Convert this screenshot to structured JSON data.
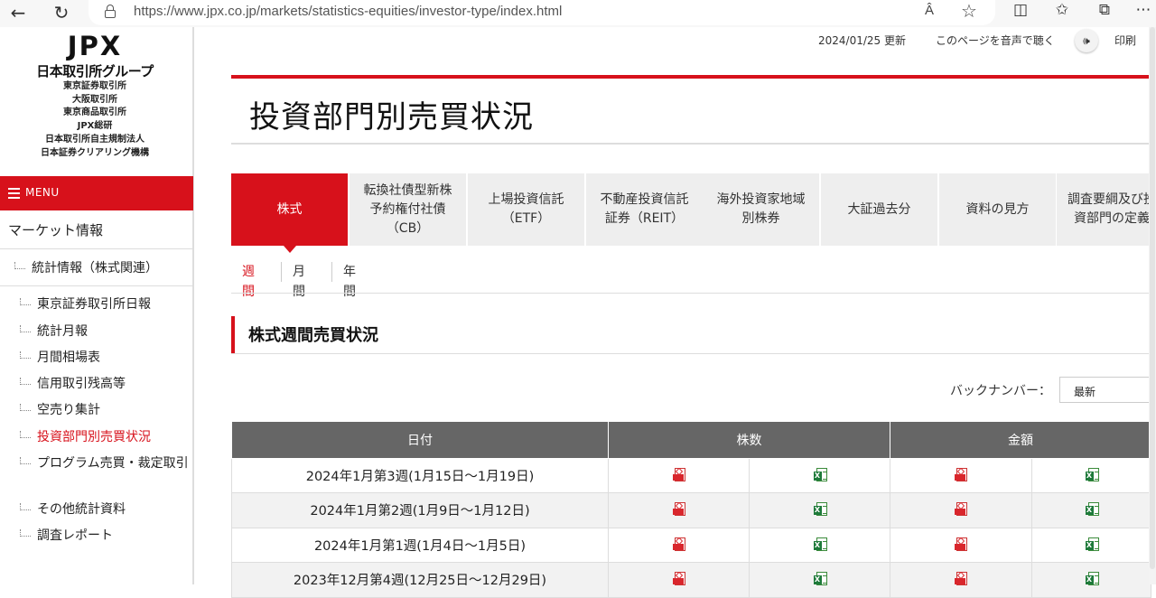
{
  "browser": {
    "url": "https://www.jpx.co.jp/markets/statistics-equities/investor-type/index.html",
    "read_aloud_label": "Â",
    "icons": [
      "back-icon",
      "refresh-icon",
      "lock-icon",
      "favorite-star-icon",
      "split-screen-icon",
      "favorites-icon",
      "collections-icon",
      "more-icon"
    ]
  },
  "logo": {
    "brand": "JPX",
    "group": "日本取引所グループ",
    "subsidiaries": [
      "東京証券取引所",
      "大阪取引所",
      "東京商品取引所",
      "JPX総研",
      "日本取引所自主規制法人",
      "日本証券クリアリング機構"
    ]
  },
  "sidebar": {
    "menu_label": "MENU",
    "heading": "マーケット情報",
    "level1": "統計情報（株式関連）",
    "items": [
      {
        "label": "東京証券取引所日報",
        "active": false
      },
      {
        "label": "統計月報",
        "active": false
      },
      {
        "label": "月間相場表",
        "active": false
      },
      {
        "label": "信用取引残高等",
        "active": false
      },
      {
        "label": "空売り集計",
        "active": false
      },
      {
        "label": "投資部門別売買状況",
        "active": true
      },
      {
        "label": "プログラム売買・裁定取引",
        "active": false
      },
      {
        "label": "その他統計資料",
        "active": false
      },
      {
        "label": "調査レポート",
        "active": false
      }
    ]
  },
  "utility": {
    "updated": "2024/01/25 更新",
    "listen": "このページを音声で聴く",
    "print": "印刷"
  },
  "page": {
    "title": "投資部門別売買状況"
  },
  "tabs": [
    {
      "label": "株式",
      "active": true
    },
    {
      "label": "転換社債型新株\n予約権付社債\n（CB）",
      "active": false
    },
    {
      "label": "上場投資信託\n（ETF）",
      "active": false
    },
    {
      "label": "不動産投資信託\n証券（REIT）",
      "active": false
    },
    {
      "label": "海外投資家地域\n別株券",
      "active": false
    },
    {
      "label": "大証過去分",
      "active": false
    },
    {
      "label": "資料の見方",
      "active": false
    },
    {
      "label": "調査要綱及び投\n資部門の定義",
      "active": false
    }
  ],
  "subtabs": [
    {
      "label": "週間",
      "active": true
    },
    {
      "label": "月間",
      "active": false
    },
    {
      "label": "年間",
      "active": false
    }
  ],
  "section": {
    "heading": "株式週間売買状況",
    "back_number_label": "バックナンバー：",
    "back_number_value": "最新"
  },
  "table": {
    "headers": [
      "日付",
      "株数",
      "金額"
    ],
    "rows": [
      {
        "date": "2024年1月第3週(1月15日～1月19日)"
      },
      {
        "date": "2024年1月第2週(1月9日～1月12日)"
      },
      {
        "date": "2024年1月第1週(1月4日～1月5日)"
      },
      {
        "date": "2023年12月第4週(12月25日～12月29日)"
      }
    ],
    "file_icons": [
      "pdf-icon",
      "excel-icon",
      "pdf-icon",
      "excel-icon"
    ]
  },
  "colors": {
    "brand_red": "#d7111b",
    "table_header": "#666666",
    "tab_bg": "#eeeeee"
  }
}
